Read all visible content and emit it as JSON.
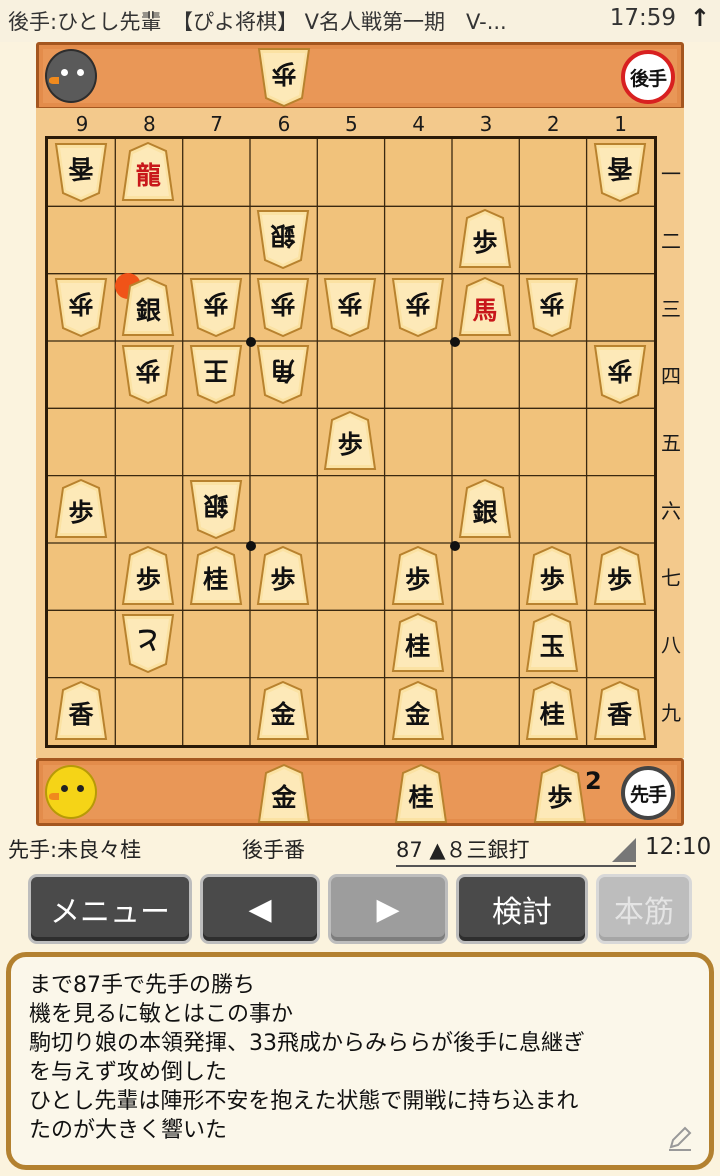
{
  "status_bar": {
    "title": "後手:ひとし先輩　【ぴよ将棋】 V名人戦第一期　V-...",
    "time": "17:59",
    "sync_icon": "up-arrow-icon"
  },
  "gote_hand": {
    "avatar": "black-chick-avatar",
    "badge": "後手",
    "pieces": [
      {
        "label": "歩",
        "count": ""
      }
    ]
  },
  "sente_hand": {
    "avatar": "yellow-chick-avatar",
    "badge": "先手",
    "pieces": [
      {
        "label": "金",
        "count": ""
      },
      {
        "label": "桂",
        "count": ""
      },
      {
        "label": "歩",
        "count": "2"
      }
    ]
  },
  "board": {
    "columns": [
      "9",
      "8",
      "7",
      "6",
      "5",
      "4",
      "3",
      "2",
      "1"
    ],
    "rows": [
      "一",
      "二",
      "三",
      "四",
      "五",
      "六",
      "七",
      "八",
      "九"
    ],
    "last_move_square": "8三",
    "pieces": [
      {
        "file": 9,
        "rank": 1,
        "label": "香",
        "owner": "gote"
      },
      {
        "file": 8,
        "rank": 1,
        "label": "龍",
        "owner": "sente",
        "promoted": true
      },
      {
        "file": 1,
        "rank": 1,
        "label": "香",
        "owner": "gote"
      },
      {
        "file": 6,
        "rank": 2,
        "label": "銀",
        "owner": "gote"
      },
      {
        "file": 3,
        "rank": 2,
        "label": "歩",
        "owner": "sente"
      },
      {
        "file": 9,
        "rank": 3,
        "label": "歩",
        "owner": "gote"
      },
      {
        "file": 8,
        "rank": 3,
        "label": "銀",
        "owner": "sente"
      },
      {
        "file": 7,
        "rank": 3,
        "label": "歩",
        "owner": "gote"
      },
      {
        "file": 6,
        "rank": 3,
        "label": "歩",
        "owner": "gote"
      },
      {
        "file": 5,
        "rank": 3,
        "label": "歩",
        "owner": "gote"
      },
      {
        "file": 4,
        "rank": 3,
        "label": "歩",
        "owner": "gote"
      },
      {
        "file": 3,
        "rank": 3,
        "label": "馬",
        "owner": "sente",
        "promoted": true
      },
      {
        "file": 2,
        "rank": 3,
        "label": "歩",
        "owner": "gote"
      },
      {
        "file": 8,
        "rank": 4,
        "label": "歩",
        "owner": "gote"
      },
      {
        "file": 7,
        "rank": 4,
        "label": "王",
        "owner": "gote"
      },
      {
        "file": 6,
        "rank": 4,
        "label": "角",
        "owner": "gote"
      },
      {
        "file": 1,
        "rank": 4,
        "label": "歩",
        "owner": "gote"
      },
      {
        "file": 5,
        "rank": 5,
        "label": "歩",
        "owner": "sente"
      },
      {
        "file": 9,
        "rank": 6,
        "label": "歩",
        "owner": "sente"
      },
      {
        "file": 7,
        "rank": 6,
        "label": "銀",
        "owner": "gote"
      },
      {
        "file": 3,
        "rank": 6,
        "label": "銀",
        "owner": "sente"
      },
      {
        "file": 8,
        "rank": 7,
        "label": "歩",
        "owner": "sente"
      },
      {
        "file": 7,
        "rank": 7,
        "label": "桂",
        "owner": "sente"
      },
      {
        "file": 6,
        "rank": 7,
        "label": "歩",
        "owner": "sente"
      },
      {
        "file": 4,
        "rank": 7,
        "label": "歩",
        "owner": "sente"
      },
      {
        "file": 2,
        "rank": 7,
        "label": "歩",
        "owner": "sente"
      },
      {
        "file": 1,
        "rank": 7,
        "label": "歩",
        "owner": "sente"
      },
      {
        "file": 8,
        "rank": 8,
        "label": "と",
        "owner": "gote"
      },
      {
        "file": 4,
        "rank": 8,
        "label": "桂",
        "owner": "sente"
      },
      {
        "file": 2,
        "rank": 8,
        "label": "玉",
        "owner": "sente"
      },
      {
        "file": 9,
        "rank": 9,
        "label": "香",
        "owner": "sente"
      },
      {
        "file": 6,
        "rank": 9,
        "label": "金",
        "owner": "sente"
      },
      {
        "file": 4,
        "rank": 9,
        "label": "金",
        "owner": "sente"
      },
      {
        "file": 2,
        "rank": 9,
        "label": "桂",
        "owner": "sente"
      },
      {
        "file": 1,
        "rank": 9,
        "label": "香",
        "owner": "sente"
      }
    ]
  },
  "info": {
    "sente_player": "先手:未良々桂",
    "turn": "後手番",
    "move": "87 ▲８三銀打",
    "elapsed": "12:10"
  },
  "buttons": {
    "menu": "メニュー",
    "prev": "◀",
    "next": "▶",
    "analyze": "検討",
    "mainline": "本筋"
  },
  "comment": {
    "lines": [
      "まで87手で先手の勝ち",
      "機を見るに敏とはこの事か",
      "駒切り娘の本領発揮、33飛成からみららが後手に息継ぎ",
      "を与えず攻め倒した",
      "ひとし先輩は陣形不安を抱えた状態で開戦に持ち込まれ",
      "たのが大きく響いた"
    ],
    "edit_icon": "pencil-icon"
  },
  "colors": {
    "board": "#f1c27b",
    "hand_bar": "#e38c4b",
    "promoted_text": "#c8171a",
    "marker": "#f05318"
  }
}
